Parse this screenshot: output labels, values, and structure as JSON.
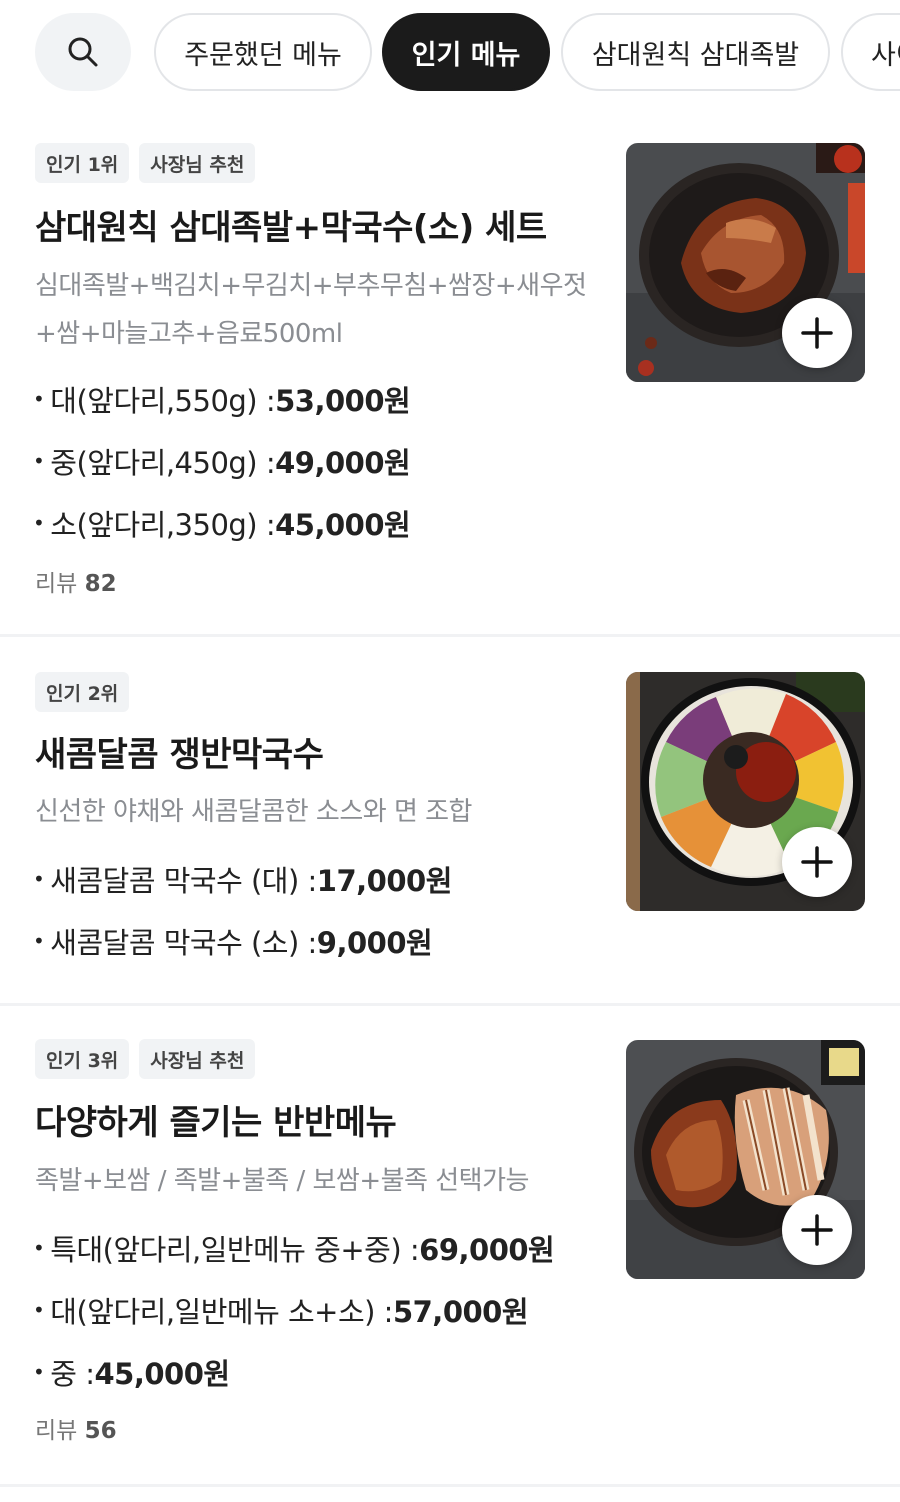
{
  "filters": {
    "search_icon": "search-icon",
    "chips": [
      {
        "label": "주문했던 메뉴",
        "active": false
      },
      {
        "label": "인기 메뉴",
        "active": true
      },
      {
        "label": "삼대원칙 삼대족발",
        "active": false
      },
      {
        "label": "사이",
        "active": false
      }
    ]
  },
  "menu_items": [
    {
      "badges": [
        "인기 1위",
        "사장님 추천"
      ],
      "title": "삼대원칙 삼대족발+막국수(소) 세트",
      "description": "심대족발+백김치+무김치+부추무침+쌈장+새우젓+쌈+마늘고추+음료500ml",
      "prices": [
        {
          "label": "대(앞다리,550g) : ",
          "value": "53,000원"
        },
        {
          "label": "중(앞다리,450g) : ",
          "value": "49,000원"
        },
        {
          "label": "소(앞다리,350g) : ",
          "value": "45,000원"
        }
      ],
      "review_label": "리뷰",
      "review_count": "82",
      "image": "jokbal-platter-photo",
      "add_icon": "plus-icon"
    },
    {
      "badges": [
        "인기 2위"
      ],
      "title": "새콤달콤 쟁반막국수",
      "description": "신선한 야채와 새콤달콤한 소스와 면 조합",
      "prices": [
        {
          "label": "새콤달콤 막국수 (대) : ",
          "value": "17,000원"
        },
        {
          "label": "새콤달콤 막국수 (소) : ",
          "value": "9,000원"
        }
      ],
      "image": "makguksu-platter-photo",
      "add_icon": "plus-icon"
    },
    {
      "badges": [
        "인기 3위",
        "사장님 추천"
      ],
      "title": "다양하게 즐기는 반반메뉴",
      "description": "족발+보쌈 / 족발+불족 / 보쌈+불족 선택가능",
      "prices": [
        {
          "label": "특대(앞다리,일반메뉴 중+중) : ",
          "value": "69,000원"
        },
        {
          "label": "대(앞다리,일반메뉴 소+소) : ",
          "value": "57,000원"
        },
        {
          "label": "중 : ",
          "value": "45,000원"
        }
      ],
      "review_label": "리뷰",
      "review_count": "56",
      "image": "banban-platter-photo",
      "add_icon": "plus-icon"
    }
  ],
  "colors": {
    "active_chip_bg": "#1b1b1b",
    "badge_bg": "#f1f3f5",
    "description_text": "#8a8d92"
  }
}
